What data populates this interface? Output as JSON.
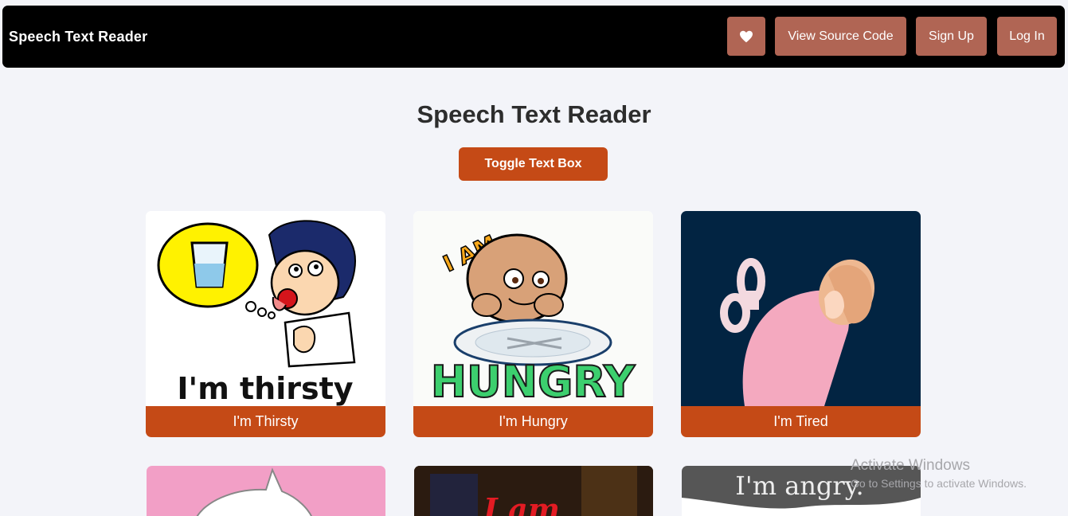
{
  "navbar": {
    "brand": "Speech Text Reader",
    "heart_icon": "heart-icon",
    "view_source_label": "View Source Code",
    "signup_label": "Sign Up",
    "login_label": "Log In",
    "bg_color": "#000000",
    "button_color": "#b06554"
  },
  "main": {
    "title": "Speech Text Reader",
    "toggle_label": "Toggle Text Box",
    "accent_color": "#c54a16"
  },
  "cards": [
    {
      "label": "I'm Thirsty",
      "image_text": "I'm thirsty"
    },
    {
      "label": "I'm Hungry",
      "image_text": "HUNGRY",
      "image_text_top": "I AM"
    },
    {
      "label": "I'm Tired"
    }
  ],
  "cards_row2": [
    {
      "image_text": ""
    },
    {
      "image_text": "I am"
    },
    {
      "image_text": "I'm angry."
    }
  ],
  "watermark": {
    "line1": "Activate Windows",
    "line2": "Go to Settings to activate Windows."
  }
}
